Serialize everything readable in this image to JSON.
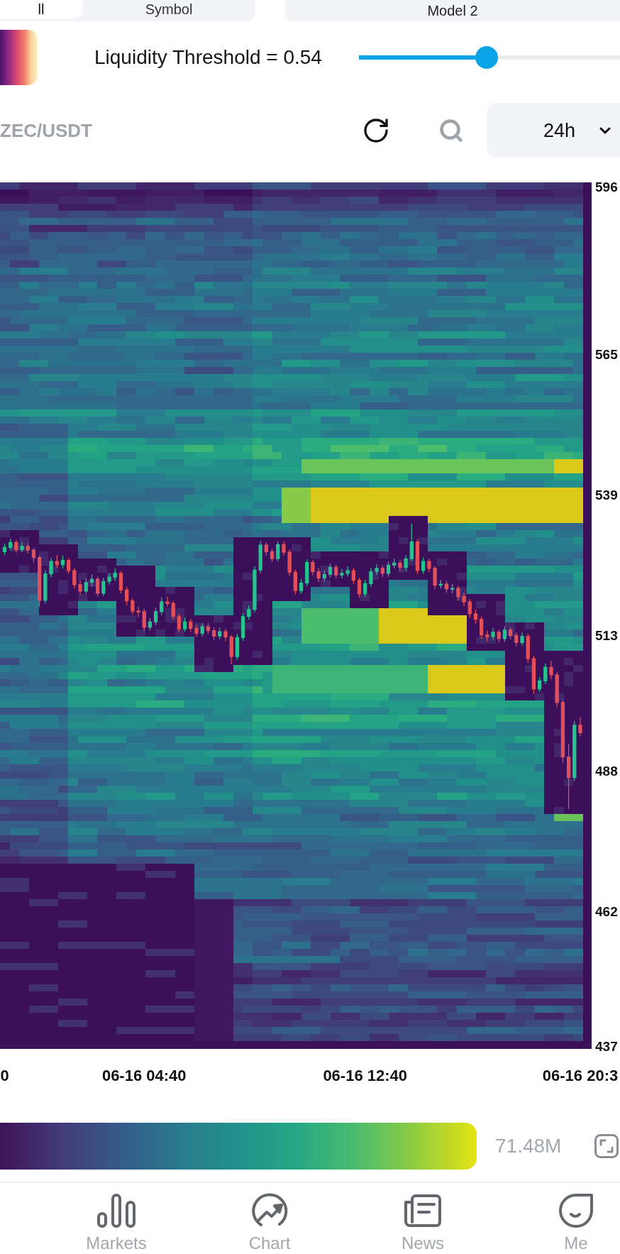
{
  "segmented_tabs": [
    {
      "label": "ll",
      "selected": true
    },
    {
      "label": "Symbol",
      "selected": false
    }
  ],
  "model_select": {
    "value": "Model 2"
  },
  "threshold": {
    "label": "Liquidity Threshold = 0.54",
    "level": 0.49
  },
  "toolbar": {
    "symbol": "ZEC/USDT",
    "range_select": {
      "value": "24h"
    }
  },
  "chart": {
    "chart_data": {
      "type": "candlestick",
      "categories": [
        "0",
        null,
        null,
        null,
        null,
        null,
        null,
        null,
        null,
        null,
        null,
        null,
        null,
        null,
        null,
        null,
        null,
        null,
        null,
        null,
        null,
        null,
        null,
        null,
        "06-16 04:40",
        null,
        null,
        null,
        null,
        null,
        null,
        null,
        null,
        null,
        null,
        null,
        null,
        null,
        null,
        null,
        null,
        null,
        null,
        null,
        null,
        null,
        null,
        null,
        null,
        null,
        null,
        null,
        null,
        null,
        null,
        null,
        null,
        null,
        null,
        null,
        null,
        null,
        "06-16 12:40",
        null,
        null,
        null,
        null,
        null,
        null,
        null,
        null,
        null,
        null,
        null,
        null,
        null,
        null,
        null,
        null,
        null,
        null,
        null,
        null,
        null,
        null,
        null,
        null,
        null,
        null,
        null,
        null,
        null,
        null,
        null,
        null,
        null,
        null,
        null,
        null,
        "06-16 20:3"
      ],
      "ohlc": [
        [
          528.6,
          530.1,
          528.0,
          529.4
        ],
        [
          529.4,
          531.0,
          528.9,
          530.3
        ],
        [
          530.3,
          530.8,
          528.4,
          529.0
        ],
        [
          529.0,
          530.4,
          528.5,
          529.6
        ],
        [
          529.6,
          530.2,
          528.3,
          528.9
        ],
        [
          528.9,
          529.3,
          526.6,
          527.5
        ],
        [
          527.5,
          527.9,
          518.4,
          519.6
        ],
        [
          519.6,
          525.2,
          519.0,
          524.5
        ],
        [
          524.5,
          527.4,
          523.9,
          526.8
        ],
        [
          526.8,
          528.0,
          525.6,
          526.2
        ],
        [
          526.2,
          527.9,
          525.5,
          527.0
        ],
        [
          527.0,
          527.4,
          524.5,
          525.1
        ],
        [
          525.1,
          525.6,
          521.8,
          522.5
        ],
        [
          522.5,
          523.4,
          520.6,
          521.3
        ],
        [
          521.3,
          523.6,
          520.8,
          522.9
        ],
        [
          522.9,
          524.4,
          522.2,
          523.5
        ],
        [
          523.5,
          524.0,
          520.3,
          520.9
        ],
        [
          520.9,
          523.8,
          520.4,
          523.1
        ],
        [
          523.1,
          524.6,
          522.5,
          523.9
        ],
        [
          523.9,
          525.5,
          523.2,
          524.6
        ],
        [
          524.6,
          525.0,
          520.9,
          521.5
        ],
        [
          521.5,
          522.1,
          518.7,
          519.5
        ],
        [
          519.5,
          520.0,
          517.0,
          517.6
        ],
        [
          517.6,
          518.4,
          516.5,
          517.5
        ],
        [
          517.5,
          518.0,
          513.9,
          514.6
        ],
        [
          514.6,
          516.3,
          514.0,
          515.6
        ],
        [
          515.6,
          518.2,
          515.0,
          517.5
        ],
        [
          517.5,
          520.1,
          516.9,
          519.3
        ],
        [
          519.3,
          520.3,
          518.4,
          519.0
        ],
        [
          519.0,
          519.5,
          516.0,
          516.6
        ],
        [
          516.6,
          517.1,
          513.6,
          514.3
        ],
        [
          514.3,
          516.4,
          513.8,
          515.6
        ],
        [
          515.6,
          516.2,
          513.7,
          514.4
        ],
        [
          514.4,
          515.1,
          512.8,
          513.5
        ],
        [
          513.5,
          515.3,
          512.9,
          514.7
        ],
        [
          514.7,
          515.4,
          513.3,
          514.0
        ],
        [
          514.0,
          514.6,
          512.3,
          513.0
        ],
        [
          513.0,
          514.5,
          512.4,
          513.8
        ],
        [
          513.8,
          514.3,
          512.0,
          512.8
        ],
        [
          512.8,
          513.2,
          507.8,
          509.2
        ],
        [
          509.2,
          513.4,
          508.6,
          512.7
        ],
        [
          512.7,
          517.2,
          512.1,
          516.6
        ],
        [
          516.6,
          518.6,
          516.0,
          517.9
        ],
        [
          517.9,
          525.9,
          517.4,
          525.2
        ],
        [
          525.2,
          530.6,
          524.6,
          529.8
        ],
        [
          529.8,
          530.4,
          527.9,
          528.6
        ],
        [
          528.6,
          529.1,
          526.7,
          527.3
        ],
        [
          527.3,
          530.5,
          526.8,
          529.9
        ],
        [
          529.9,
          530.5,
          527.9,
          528.5
        ],
        [
          528.5,
          529.0,
          524.1,
          524.8
        ],
        [
          524.8,
          525.3,
          520.7,
          521.4
        ],
        [
          521.4,
          523.5,
          520.8,
          522.8
        ],
        [
          522.8,
          527.2,
          522.2,
          526.6
        ],
        [
          526.6,
          527.1,
          524.2,
          524.9
        ],
        [
          524.9,
          525.6,
          523.0,
          523.7
        ],
        [
          523.7,
          525.1,
          523.1,
          524.4
        ],
        [
          524.4,
          526.4,
          523.8,
          525.7
        ],
        [
          525.7,
          526.2,
          523.6,
          524.3
        ],
        [
          524.3,
          525.4,
          523.7,
          524.6
        ],
        [
          524.6,
          525.9,
          524.0,
          525.1
        ],
        [
          525.1,
          525.6,
          522.6,
          523.3
        ],
        [
          523.3,
          523.8,
          520.1,
          520.8
        ],
        [
          520.8,
          523.4,
          520.2,
          522.7
        ],
        [
          522.7,
          525.6,
          522.1,
          524.9
        ],
        [
          524.9,
          526.3,
          524.3,
          525.5
        ],
        [
          525.5,
          526.1,
          523.9,
          524.6
        ],
        [
          524.6,
          526.8,
          524.0,
          526.1
        ],
        [
          526.1,
          527.3,
          525.5,
          526.5
        ],
        [
          526.5,
          527.1,
          525.0,
          525.7
        ],
        [
          525.7,
          528.0,
          525.1,
          527.3
        ],
        [
          527.3,
          533.8,
          526.8,
          530.4
        ],
        [
          530.4,
          530.9,
          524.4,
          525.1
        ],
        [
          525.1,
          527.5,
          524.5,
          526.8
        ],
        [
          526.8,
          527.3,
          524.8,
          525.5
        ],
        [
          525.5,
          526.0,
          521.7,
          522.4
        ],
        [
          522.4,
          523.4,
          521.8,
          522.6
        ],
        [
          522.6,
          523.2,
          521.0,
          521.7
        ],
        [
          521.7,
          522.6,
          520.9,
          521.8
        ],
        [
          521.8,
          522.3,
          519.6,
          520.3
        ],
        [
          520.3,
          521.0,
          518.5,
          519.3
        ],
        [
          519.3,
          519.8,
          516.4,
          517.1
        ],
        [
          517.1,
          517.9,
          515.3,
          516.1
        ],
        [
          516.1,
          516.6,
          512.5,
          513.2
        ],
        [
          513.2,
          514.0,
          512.0,
          512.9
        ],
        [
          512.9,
          514.5,
          512.3,
          513.7
        ],
        [
          513.7,
          514.2,
          511.8,
          512.5
        ],
        [
          512.5,
          514.8,
          511.9,
          514.1
        ],
        [
          514.1,
          514.7,
          512.4,
          513.1
        ],
        [
          513.1,
          513.6,
          511.1,
          511.8
        ],
        [
          511.8,
          513.6,
          511.2,
          512.9
        ],
        [
          512.9,
          513.4,
          508.0,
          508.8
        ],
        [
          508.8,
          509.3,
          502.3,
          503.2
        ],
        [
          503.2,
          505.4,
          502.6,
          504.7
        ],
        [
          504.7,
          507.9,
          504.1,
          507.2
        ],
        [
          507.2,
          508.4,
          505.0,
          505.8
        ],
        [
          505.8,
          506.3,
          499.8,
          500.7
        ],
        [
          500.7,
          501.2,
          489.5,
          490.6
        ],
        [
          490.6,
          493.0,
          481.0,
          486.8
        ],
        [
          486.8,
          497.3,
          486.2,
          496.5
        ],
        [
          496.5,
          498.0,
          494.4,
          495.1
        ]
      ],
      "ylim": [
        437,
        596
      ],
      "yticks": [
        596,
        565,
        539,
        513,
        488,
        462,
        437
      ]
    }
  },
  "legend": {
    "max_value": "71.48M"
  },
  "bottom_nav": [
    {
      "label": "Markets",
      "selected": false
    },
    {
      "label": "Chart",
      "selected": false
    },
    {
      "label": "News",
      "selected": false
    },
    {
      "label": "Me",
      "selected": false
    }
  ]
}
